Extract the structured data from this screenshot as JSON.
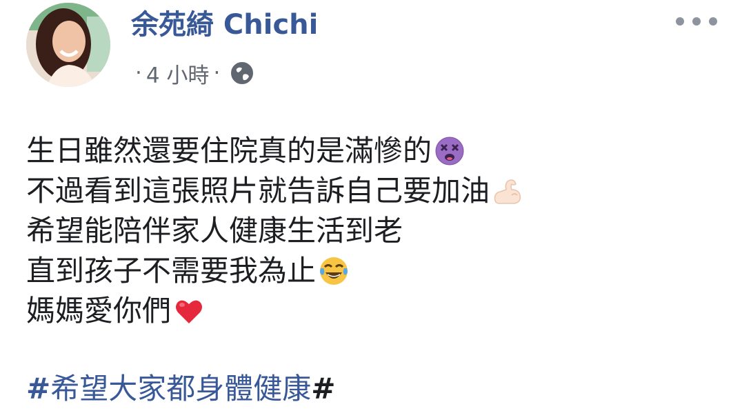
{
  "post": {
    "author_name": "余苑綺 Chichi",
    "separator_dot": "·",
    "timestamp": "4 小時",
    "privacy_icon": "globe-icon",
    "more_icon": "more-options-icon",
    "lines": [
      "生日雖然還要住院真的是滿慘的",
      "不過看到這張照片就告訴自己要加油",
      "希望能陪伴家人健康生活到老",
      "直到孩子不需要我為止",
      "媽媽愛你們"
    ],
    "emojis": [
      "dizzy-face-emoji",
      "flexed-biceps-emoji",
      "tears-of-joy-emoji",
      "red-heart-emoji"
    ],
    "hashtag": {
      "hash": "#",
      "text": "希望大家都身體健康",
      "trailing": "#"
    }
  },
  "colors": {
    "link": "#385898",
    "text": "#1c1e21",
    "meta": "#616770",
    "icon_gray": "#8d949e"
  }
}
